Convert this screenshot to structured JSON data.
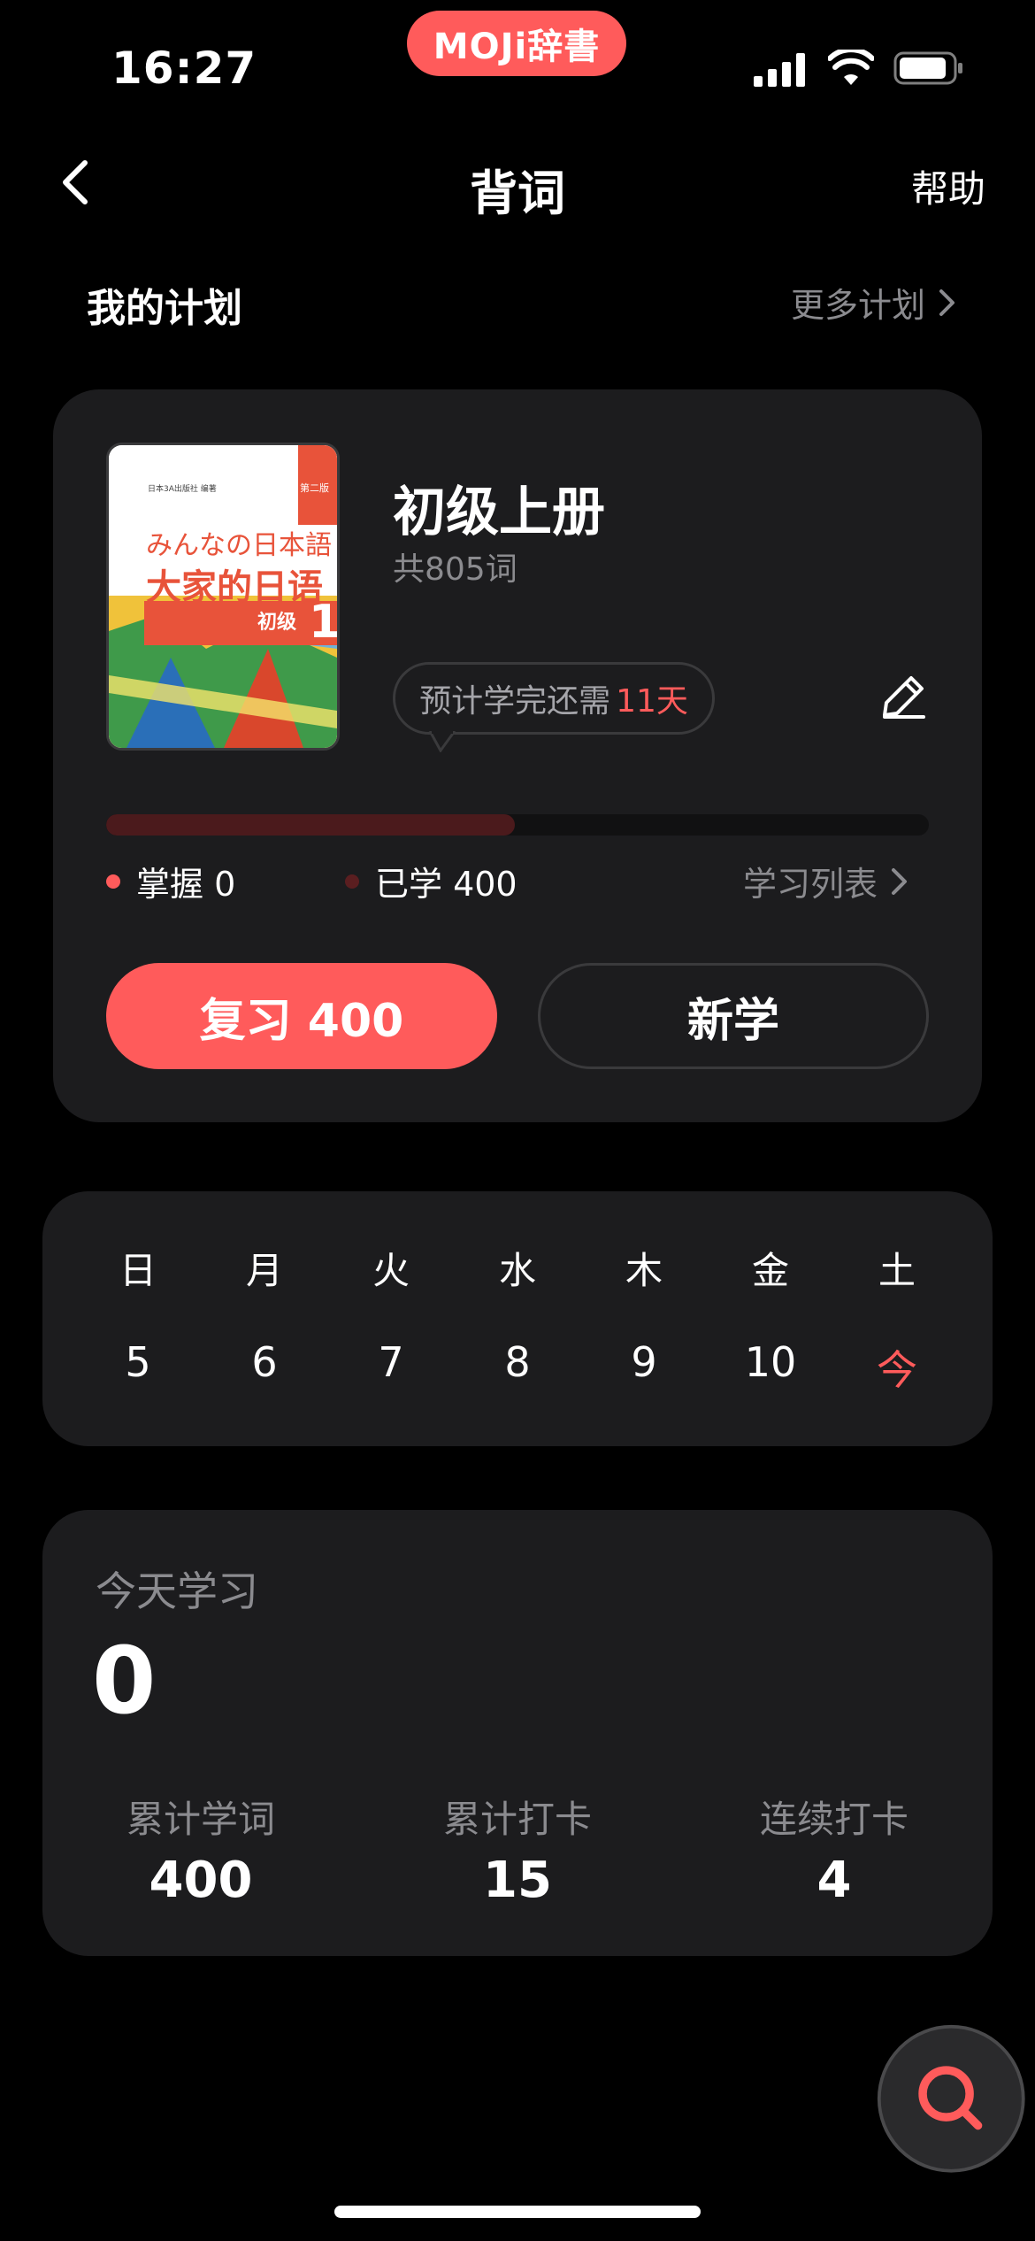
{
  "status_bar": {
    "time": "16:27",
    "app_badge": "MOJi辞書"
  },
  "nav": {
    "title": "背词",
    "help": "帮助"
  },
  "section": {
    "title": "我的计划",
    "more": "更多计划"
  },
  "plan": {
    "book": {
      "cover_small": "日本3A出版社 编著",
      "cover_edition": "第二版",
      "cover_jp": "みんなの日本語",
      "cover_cn": "大家的日语",
      "cover_level": "初级",
      "cover_num": "1"
    },
    "title": "初级上册",
    "count": "共805词",
    "bubble_prefix": "预计学完还需",
    "bubble_days": "11天",
    "progress_fraction": 0.497,
    "mastered": "掌握 0",
    "learned": "已学 400",
    "study_list": "学习列表",
    "review_btn": "复习 400",
    "new_btn": "新学"
  },
  "week": {
    "days": [
      "日",
      "月",
      "火",
      "水",
      "木",
      "金",
      "土"
    ],
    "dates": [
      "5",
      "6",
      "7",
      "8",
      "9",
      "10",
      "今"
    ]
  },
  "stats": {
    "today_label": "今天学习",
    "today_value": "0",
    "items": [
      {
        "label": "累计学词",
        "value": "400"
      },
      {
        "label": "累计打卡",
        "value": "15"
      },
      {
        "label": "连续打卡",
        "value": "4"
      }
    ]
  },
  "colors": {
    "accent": "#ff5b5b",
    "card": "#1c1c1e",
    "bg": "#000000",
    "muted": "#8b8b8f"
  }
}
